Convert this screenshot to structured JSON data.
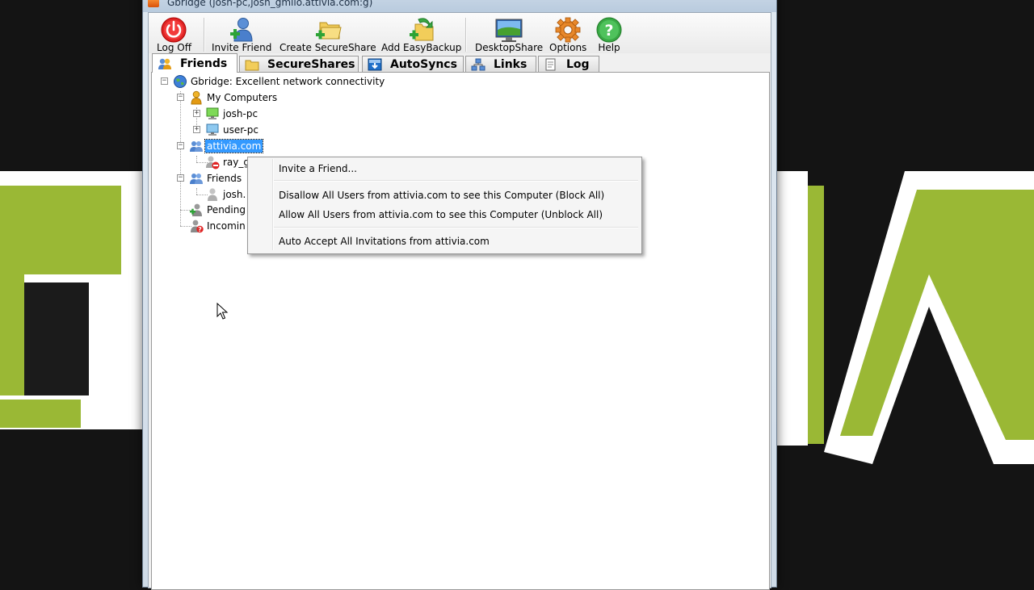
{
  "window": {
    "title": "Gbridge (josh-pc,josh_gmilo.attivia.com:g)"
  },
  "toolbar": {
    "items": [
      {
        "label": "Log Off",
        "icon": "power-icon"
      },
      {
        "label": "Invite Friend",
        "icon": "add-user-icon"
      },
      {
        "label": "Create SecureShare",
        "icon": "add-folder-icon"
      },
      {
        "label": "Add EasyBackup",
        "icon": "backup-icon"
      },
      {
        "label": "DesktopShare",
        "icon": "desktop-icon"
      },
      {
        "label": "Options",
        "icon": "gear-icon"
      },
      {
        "label": "Help",
        "icon": "help-icon"
      }
    ]
  },
  "tabs": [
    {
      "label": "Friends",
      "icon": "friends-icon",
      "active": true
    },
    {
      "label": "SecureShares",
      "icon": "folder-icon",
      "active": false
    },
    {
      "label": "AutoSyncs",
      "icon": "autosync-icon",
      "active": false
    },
    {
      "label": "Links",
      "icon": "links-icon",
      "active": false
    },
    {
      "label": "Log",
      "icon": "log-icon",
      "active": false
    }
  ],
  "tree": {
    "root": "Gbridge: Excellent network connectivity",
    "my_computers": "My Computers",
    "computer_1": "josh-pc",
    "computer_2": "user-pc",
    "domain_group": "attivia.com",
    "domain_member": "ray_g",
    "friends_group": "Friends",
    "friend_member": "josh.",
    "pending": "Pending",
    "incoming": "Incomin"
  },
  "context_menu": {
    "items": [
      "Invite a Friend...",
      "Disallow All Users from attivia.com to see this Computer (Block All)",
      "Allow All Users from attivia.com to see this Computer (Unblock All)",
      "Auto Accept All Invitations from attivia.com"
    ]
  },
  "colors": {
    "selection": "#3399ff",
    "wallpaper_green": "#9ab835",
    "wallpaper_bg": "#141414"
  }
}
